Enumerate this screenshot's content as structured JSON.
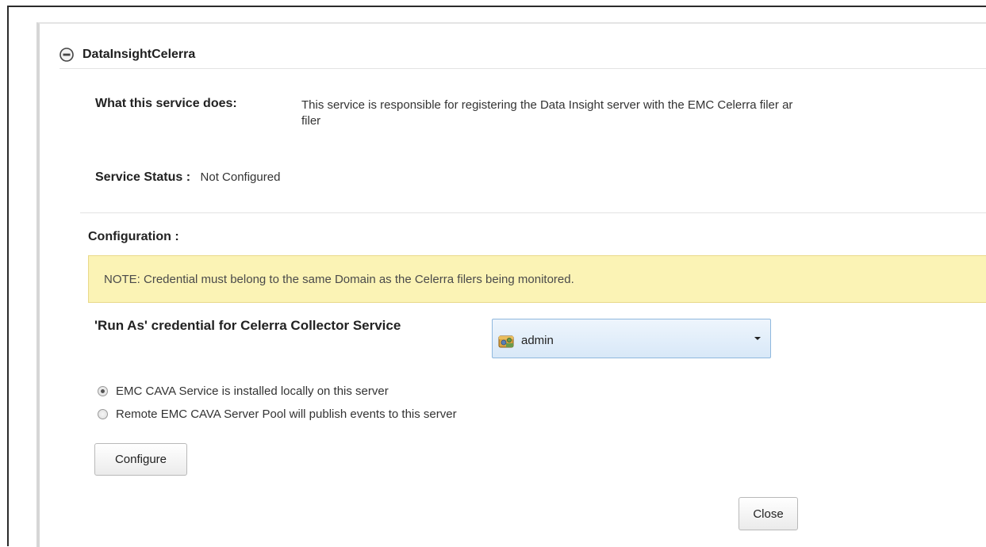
{
  "service": {
    "name": "DataInsightCelerra"
  },
  "what_this_service_does": {
    "label": "What this service does:",
    "description_line1": "This service is responsible for registering the Data Insight server with the EMC Celerra filer ar",
    "description_line2": "filer"
  },
  "status": {
    "label": "Service Status :",
    "value": "Not Configured"
  },
  "configuration": {
    "label": "Configuration :",
    "note": "NOTE: Credential must belong to the same Domain as the Celerra filers being monitored.",
    "run_as": {
      "label": "'Run As' credential for Celerra Collector Service",
      "selected": "admin"
    },
    "options": [
      {
        "label": "EMC CAVA Service is installed locally on this server",
        "checked": true
      },
      {
        "label": "Remote EMC CAVA Server Pool will publish events to this server",
        "checked": false
      }
    ],
    "configure_label": "Configure"
  },
  "footer": {
    "close_label": "Close"
  },
  "icons": {
    "collapse": "collapse-circle-icon",
    "credential": "credential-icon",
    "dropdown": "dropdown-arrow-icon"
  },
  "colors": {
    "note_background": "#fbf3b5",
    "select_border": "#8fb8de"
  }
}
